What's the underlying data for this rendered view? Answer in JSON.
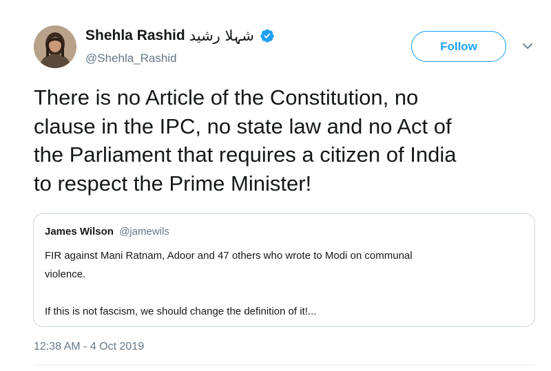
{
  "author": {
    "display_name": "Shehla Rashid",
    "display_name_urdu": "شہلا رشید",
    "handle": "@Shehla_Rashid",
    "verified": true,
    "avatar_icon": "profile-photo"
  },
  "actions": {
    "follow_label": "Follow",
    "caret_icon": "chevron-down-icon"
  },
  "tweet": {
    "text": "There is no Article of the Constitution, no\nclause in the IPC, no state law and no Act of\nthe Parliament that requires a citizen of India\nto respect the Prime Minister!",
    "timestamp": "12:38 AM - 4 Oct 2019"
  },
  "quoted_tweet": {
    "name": "James Wilson",
    "handle": "@jamewils",
    "text": "FIR against Mani Ratnam, Adoor and 47 others who wrote to Modi on communal\nviolence.\n\nIf this is not fascism, we should change the definition of it!..."
  },
  "colors": {
    "accent": "#1da1f2",
    "text_primary": "#14171a",
    "text_secondary": "#657786",
    "border": "#ccd6dd"
  }
}
